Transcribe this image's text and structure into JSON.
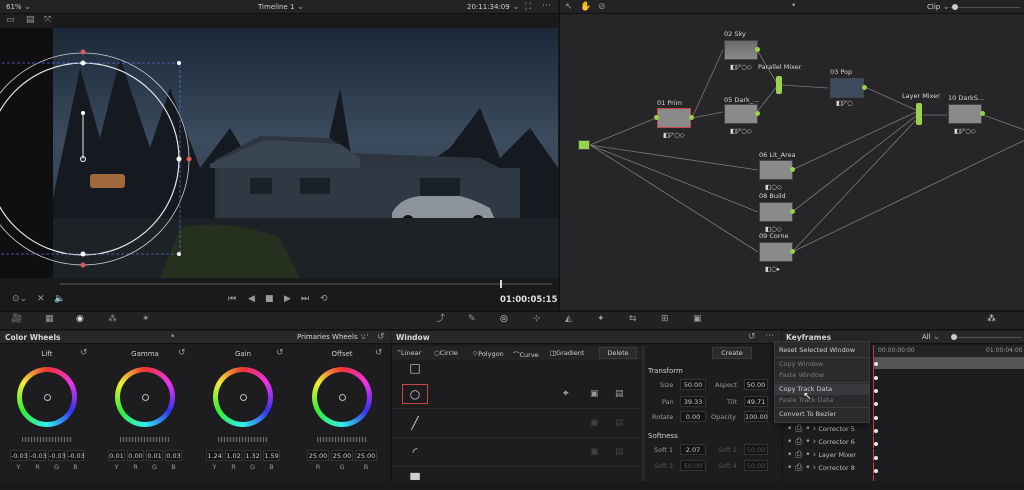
{
  "viewer": {
    "zoom": "61%",
    "timeline": "Timeline 1",
    "timecode_top": "20:11:34:09",
    "timecode_main": "01:00:05:15"
  },
  "node_editor": {
    "mode": "Clip",
    "nodes": [
      {
        "id": "01",
        "name": "Prim"
      },
      {
        "id": "02",
        "name": "Sky"
      },
      {
        "id": "03",
        "name": "Pop"
      },
      {
        "id": "05",
        "name": "Dark_..."
      },
      {
        "id": "06",
        "name": "Lit_Area"
      },
      {
        "id": "08",
        "name": "Build"
      },
      {
        "id": "09",
        "name": "Corne"
      },
      {
        "id": "10",
        "name": "DarkS..."
      }
    ],
    "mixers": [
      "Parallel Mixer",
      "Layer Mixer"
    ]
  },
  "color_wheels": {
    "title": "Color Wheels",
    "mode": "Primaries Wheels",
    "wheels": [
      {
        "name": "Lift",
        "values": [
          "-0.03",
          "-0.03",
          "-0.03",
          "-0.03"
        ]
      },
      {
        "name": "Gamma",
        "values": [
          "0.01",
          "0.00",
          "0.01",
          "0.03"
        ]
      },
      {
        "name": "Gain",
        "values": [
          "1.24",
          "1.02",
          "1.32",
          "1.59"
        ]
      },
      {
        "name": "Offset",
        "values": [
          "25.00",
          "25.00",
          "25.00"
        ]
      }
    ],
    "channel_labels_4": [
      "Y",
      "R",
      "G",
      "B"
    ],
    "channel_labels_3": [
      "R",
      "G",
      "B"
    ]
  },
  "window": {
    "title": "Window",
    "tools": [
      "Linear",
      "Circle",
      "Polygon",
      "Curve",
      "Gradient"
    ],
    "delete_label": "Delete",
    "create_label": "Create",
    "transform_title": "Transform",
    "size_label": "Size",
    "size_value": "50.00",
    "aspect_label": "Aspect",
    "aspect_value": "50.00",
    "pan_label": "Pan",
    "pan_value": "39.33",
    "tilt_label": "Tilt",
    "tilt_value": "49.71",
    "rotate_label": "Rotate",
    "rotate_value": "0.00",
    "opacity_label": "Opacity",
    "opacity_value": "100.00",
    "softness_title": "Softness",
    "soft1_label": "Soft 1",
    "soft1_value": "2.07",
    "soft2_label": "Soft 2",
    "soft2_value": "50.00",
    "soft3_label": "Soft 3",
    "soft3_value": "50.00",
    "soft4_label": "Soft 4",
    "soft4_value": "50.00"
  },
  "keyframes": {
    "title": "Keyframes",
    "filter": "All",
    "time_start": "00:00:00:00",
    "time_end": "01:00:04:00",
    "rows": [
      "Corrector 5",
      "Corrector 6",
      "Layer Mixer",
      "Corrector 8"
    ]
  },
  "context_menu": {
    "items": [
      {
        "label": "Reset Selected Window",
        "enabled": true
      },
      {
        "label": "Copy Window",
        "enabled": false
      },
      {
        "label": "Paste Window",
        "enabled": false
      },
      {
        "label": "Copy Track Data",
        "enabled": true
      },
      {
        "label": "Paste Track Data",
        "enabled": false
      },
      {
        "label": "Convert To Bezier",
        "enabled": true
      }
    ]
  }
}
